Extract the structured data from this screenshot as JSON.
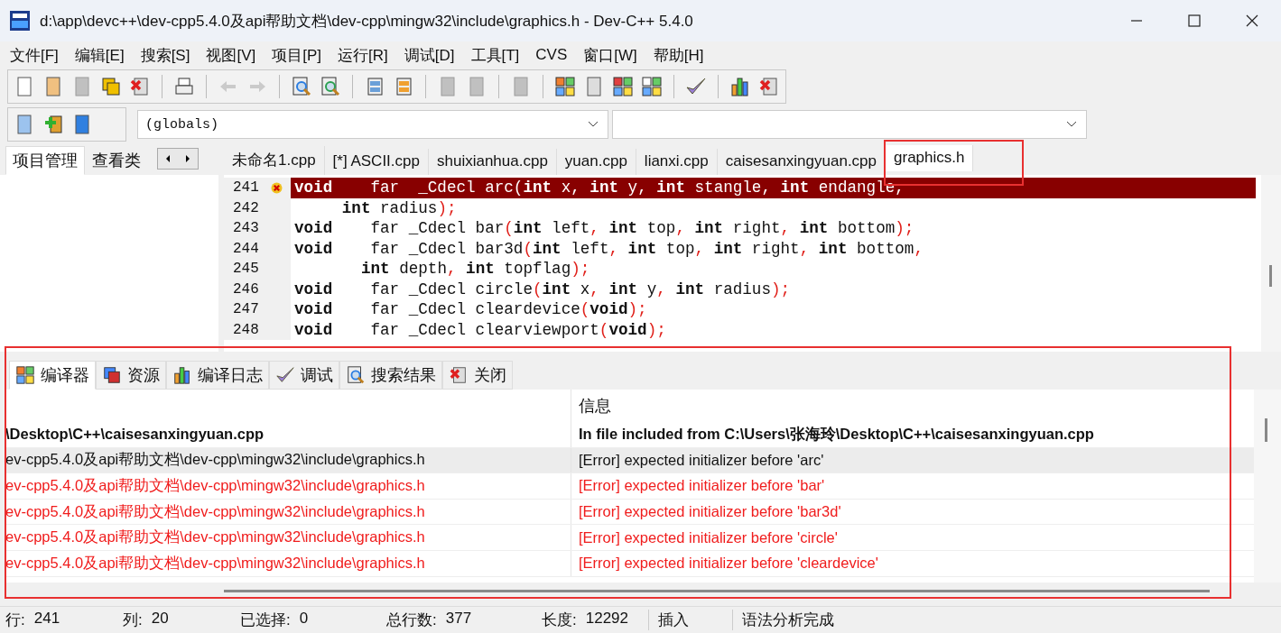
{
  "window": {
    "title": "d:\\app\\devc++\\dev-cpp5.4.0及api帮助文档\\dev-cpp\\mingw32\\include\\graphics.h - Dev-C++ 5.4.0"
  },
  "menu": [
    "文件[F]",
    "编辑[E]",
    "搜索[S]",
    "视图[V]",
    "项目[P]",
    "运行[R]",
    "调试[D]",
    "工具[T]",
    "CVS",
    "窗口[W]",
    "帮助[H]"
  ],
  "scope_combo": {
    "value": "(globals)"
  },
  "left_tabs": [
    {
      "label": "项目管理",
      "selected": true
    },
    {
      "label": "查看类",
      "selected": false
    }
  ],
  "editor_tabs": [
    {
      "label": "未命名1.cpp",
      "selected": false,
      "annotated": false
    },
    {
      "label": "[*] ASCII.cpp",
      "selected": false,
      "annotated": false
    },
    {
      "label": "shuixianhua.cpp",
      "selected": false,
      "annotated": false
    },
    {
      "label": "yuan.cpp",
      "selected": false,
      "annotated": false
    },
    {
      "label": "lianxi.cpp",
      "selected": false,
      "annotated": false
    },
    {
      "label": "caisesanxingyuan.cpp",
      "selected": false,
      "annotated": false
    },
    {
      "label": "graphics.h",
      "selected": true,
      "annotated": true
    }
  ],
  "code_lines": [
    {
      "number": "241",
      "error": true,
      "text": "**void**    far  _Cdecl arc(**int** x, **int** y, **int** stangle, **int** endangle,"
    },
    {
      "number": "242",
      "error": false,
      "text": "     **int** radius);"
    },
    {
      "number": "243",
      "error": false,
      "text": "**void**    far _Cdecl bar(**int** left, **int** top, **int** right, **int** bottom);"
    },
    {
      "number": "244",
      "error": false,
      "text": "**void**    far _Cdecl bar3d(**int** left, **int** top, **int** right, **int** bottom,"
    },
    {
      "number": "245",
      "error": false,
      "text": "       **int** depth, **int** topflag);"
    },
    {
      "number": "246",
      "error": false,
      "text": "**void**    far _Cdecl circle(**int** x, **int** y, **int** radius);"
    },
    {
      "number": "247",
      "error": false,
      "text": "**void**    far _Cdecl cleardevice(**void**);"
    },
    {
      "number": "248",
      "error": false,
      "text": "**void**    far _Cdecl clearviewport(**void**);"
    }
  ],
  "bottom_panel": {
    "annotated": true
  },
  "bottom_tabs": [
    {
      "label": "编译器",
      "selected": true
    },
    {
      "label": "资源",
      "selected": false
    },
    {
      "label": "编译日志",
      "selected": false
    },
    {
      "label": "调试",
      "selected": false
    },
    {
      "label": "搜索结果",
      "selected": false
    },
    {
      "label": "关闭",
      "selected": false
    }
  ],
  "messages": {
    "header": "信息",
    "rows": [
      {
        "kind": "include",
        "selected": false,
        "file": "\\Desktop\\C++\\caisesanxingyuan.cpp",
        "message": "In file included from C:\\Users\\张海玲\\Desktop\\C++\\caisesanxingyuan.cpp"
      },
      {
        "kind": "error",
        "selected": true,
        "file": "ev-cpp5.4.0及api帮助文档\\dev-cpp\\mingw32\\include\\graphics.h",
        "message": "[Error] expected initializer before 'arc'"
      },
      {
        "kind": "error",
        "selected": false,
        "file": "ev-cpp5.4.0及api帮助文档\\dev-cpp\\mingw32\\include\\graphics.h",
        "message": "[Error] expected initializer before 'bar'"
      },
      {
        "kind": "error",
        "selected": false,
        "file": "ev-cpp5.4.0及api帮助文档\\dev-cpp\\mingw32\\include\\graphics.h",
        "message": "[Error] expected initializer before 'bar3d'"
      },
      {
        "kind": "error",
        "selected": false,
        "file": "ev-cpp5.4.0及api帮助文档\\dev-cpp\\mingw32\\include\\graphics.h",
        "message": "[Error] expected initializer before 'circle'"
      },
      {
        "kind": "error",
        "selected": false,
        "file": "ev-cpp5.4.0及api帮助文档\\dev-cpp\\mingw32\\include\\graphics.h",
        "message": "[Error] expected initializer before 'cleardevice'"
      }
    ]
  },
  "status_bar": {
    "fields": [
      {
        "label": "行:",
        "value": "241"
      },
      {
        "label": "列:",
        "value": "20"
      },
      {
        "label": "已选择:",
        "value": "0"
      },
      {
        "label": "总行数:",
        "value": "377"
      },
      {
        "label": "长度:",
        "value": "12292"
      }
    ],
    "mode": "插入",
    "message": "语法分析完成"
  }
}
